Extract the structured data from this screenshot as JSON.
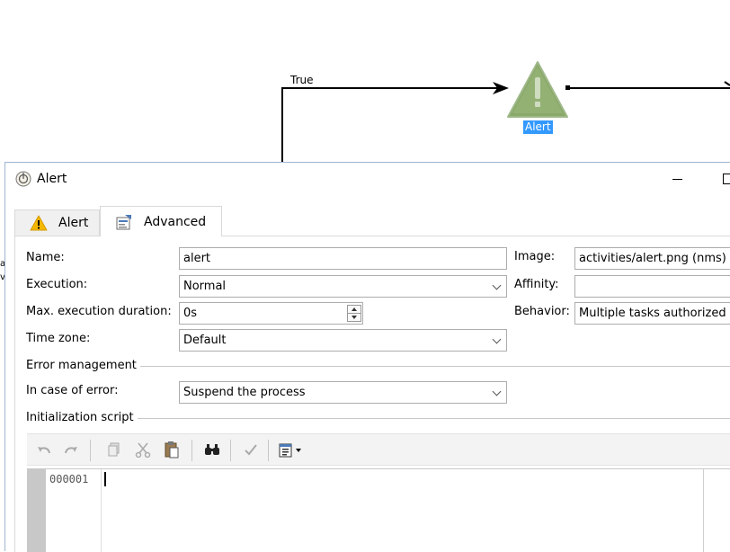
{
  "workflow": {
    "transition_label": "True",
    "activity_label": "Alert",
    "left_sliver_text": "a\nv"
  },
  "window": {
    "title": "Alert"
  },
  "tabs": [
    {
      "label": "Alert",
      "icon": "warning-icon",
      "active": false
    },
    {
      "label": "Advanced",
      "icon": "properties-icon",
      "active": true
    }
  ],
  "form": {
    "name_label": "Name:",
    "name_value": "alert",
    "execution_label": "Execution:",
    "execution_value": "Normal",
    "max_duration_label": "Max. execution duration:",
    "max_duration_value": "0s",
    "timezone_label": "Time zone:",
    "timezone_value": "Default",
    "image_label": "Image:",
    "image_value": "activities/alert.png (nms)",
    "affinity_label": "Affinity:",
    "affinity_value": "",
    "behavior_label": "Behavior:",
    "behavior_value": "Multiple tasks authorized"
  },
  "error_management": {
    "title": "Error management",
    "in_case_label": "In case of error:",
    "in_case_value": "Suspend the process"
  },
  "init_script": {
    "title": "Initialization script",
    "line_number": "000001"
  },
  "toolbar": {
    "buttons": [
      "undo-icon",
      "redo-icon",
      "copy-icon",
      "cut-icon",
      "paste-icon",
      "find-icon",
      "check-syntax-icon",
      "insert-menu-icon"
    ]
  },
  "colors": {
    "selection": "#3399ff",
    "warning_triangle": "#8aa86a",
    "tab_warning": "#f5b800",
    "dialog_border": "#9eb5cf"
  }
}
